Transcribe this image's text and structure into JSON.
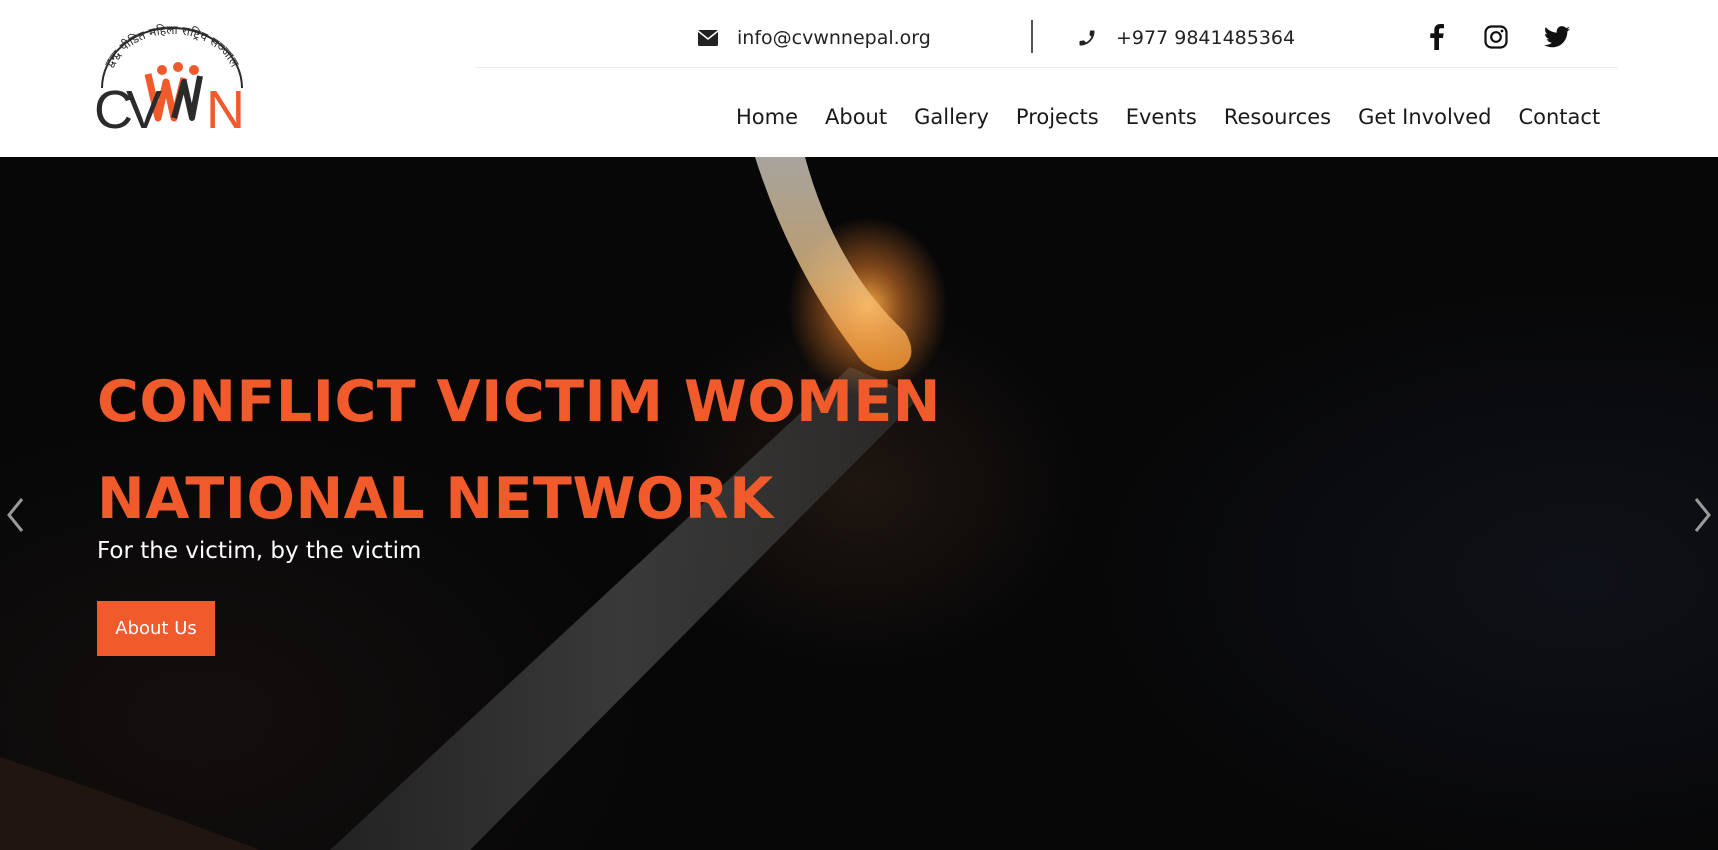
{
  "brand": {
    "logo_text": "CVWN",
    "logo_arc_text": "द्वन्द्व पीडित महिला राष्ट्रिय सञ्जाल",
    "accent_color": "#f15a2b"
  },
  "topbar": {
    "email": {
      "icon": "envelope-icon",
      "text": "info@cvwnnepal.org"
    },
    "phone": {
      "icon": "phone-icon",
      "text": "+977 9841485364"
    },
    "social": [
      {
        "icon": "facebook-icon"
      },
      {
        "icon": "instagram-icon"
      },
      {
        "icon": "twitter-icon"
      }
    ]
  },
  "nav": {
    "items": [
      "Home",
      "About",
      "Gallery",
      "Projects",
      "Events",
      "Resources",
      "Get Involved",
      "Contact"
    ]
  },
  "hero": {
    "title_line1": "CONFLICT VICTIM WOMEN",
    "title_line2": "NATIONAL NETWORK",
    "subtitle": "For the victim, by the victim",
    "button_label": "About Us",
    "prev_icon": "chevron-left-icon",
    "next_icon": "chevron-right-icon"
  }
}
